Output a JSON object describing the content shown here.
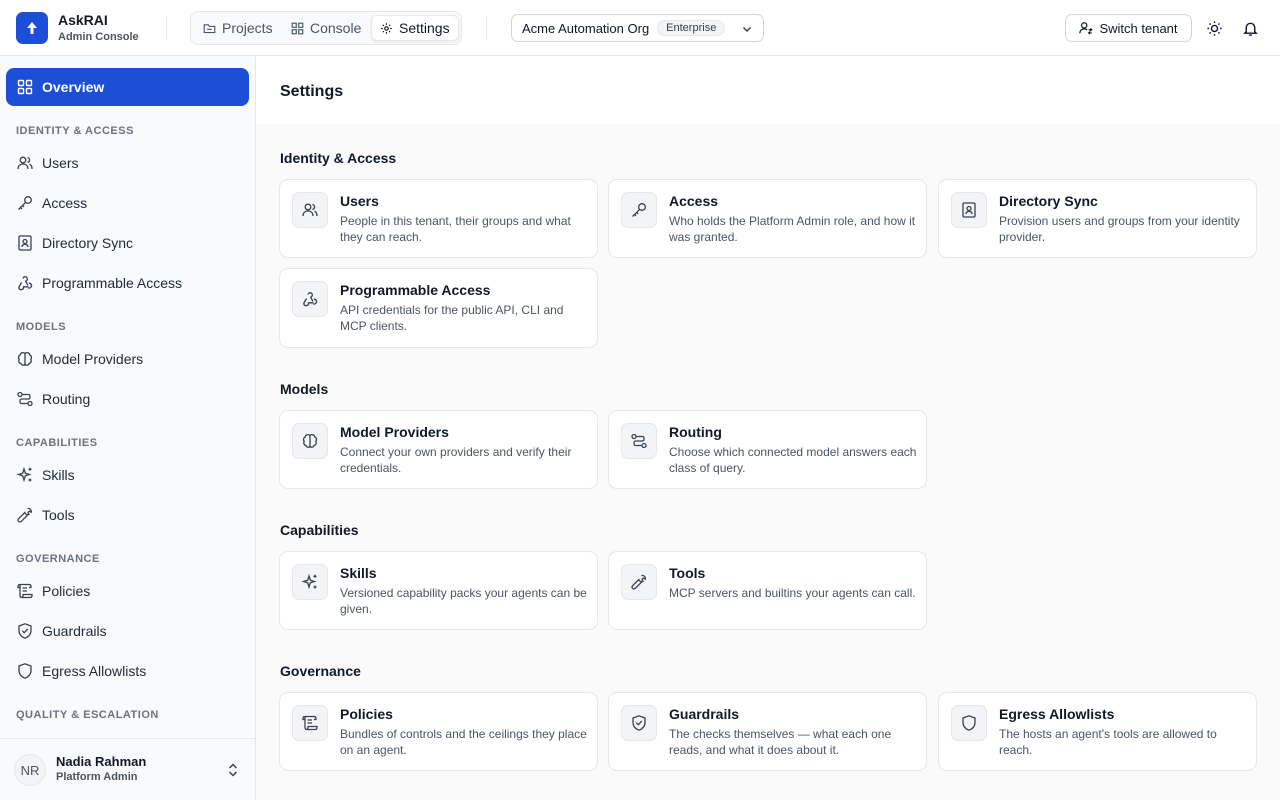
{
  "brand": {
    "name": "AskRAI",
    "subtitle": "Admin Console"
  },
  "top_tabs": [
    {
      "label": "Projects",
      "icon": "folder-icon"
    },
    {
      "label": "Console",
      "icon": "grid-icon"
    },
    {
      "label": "Settings",
      "icon": "gear-icon",
      "active": true
    }
  ],
  "org_selector": {
    "name": "Acme Automation Org",
    "badge": "Enterprise"
  },
  "switch_tenant_label": "Switch tenant",
  "sidebar": {
    "overview_label": "Overview",
    "sections": [
      {
        "title": "IDENTITY & ACCESS",
        "items": [
          "Users",
          "Access",
          "Directory Sync",
          "Programmable Access"
        ]
      },
      {
        "title": "MODELS",
        "items": [
          "Model Providers",
          "Routing"
        ]
      },
      {
        "title": "CAPABILITIES",
        "items": [
          "Skills",
          "Tools"
        ]
      },
      {
        "title": "GOVERNANCE",
        "items": [
          "Policies",
          "Guardrails",
          "Egress Allowlists"
        ]
      },
      {
        "title": "QUALITY & ESCALATION",
        "items": []
      }
    ],
    "user": {
      "initials": "NR",
      "name": "Nadia Rahman",
      "role": "Platform Admin"
    }
  },
  "main": {
    "title": "Settings",
    "sections": [
      {
        "title": "Identity & Access",
        "cards": [
          {
            "title": "Users",
            "desc": "People in this tenant, their groups and what they can reach.",
            "icon": "users-icon"
          },
          {
            "title": "Access",
            "desc": "Who holds the Platform Admin role, and how it was granted.",
            "icon": "key-icon"
          },
          {
            "title": "Directory Sync",
            "desc": "Provision users and groups from your identity provider.",
            "icon": "contact-book-icon"
          },
          {
            "title": "Programmable Access",
            "desc": "API credentials for the public API, CLI and MCP clients.",
            "icon": "webhook-icon"
          }
        ]
      },
      {
        "title": "Models",
        "cards": [
          {
            "title": "Model Providers",
            "desc": "Connect your own providers and verify their credentials.",
            "icon": "brain-icon"
          },
          {
            "title": "Routing",
            "desc": "Choose which connected model answers each class of query.",
            "icon": "route-icon"
          }
        ]
      },
      {
        "title": "Capabilities",
        "cards": [
          {
            "title": "Skills",
            "desc": "Versioned capability packs your agents can be given.",
            "icon": "sparkles-icon"
          },
          {
            "title": "Tools",
            "desc": "MCP servers and builtins your agents can call.",
            "icon": "wrench-icon"
          }
        ]
      },
      {
        "title": "Governance",
        "cards": [
          {
            "title": "Policies",
            "desc": "Bundles of controls and the ceilings they place on an agent.",
            "icon": "scroll-icon"
          },
          {
            "title": "Guardrails",
            "desc": "The checks themselves — what each one reads, and what it does about it.",
            "icon": "shield-check-icon"
          },
          {
            "title": "Egress Allowlists",
            "desc": "The hosts an agent's tools are allowed to reach.",
            "icon": "shield-icon"
          }
        ]
      }
    ]
  },
  "colors": {
    "accent": "#1d4ed8",
    "border": "#e5e7eb",
    "muted_text": "#4b5563"
  }
}
